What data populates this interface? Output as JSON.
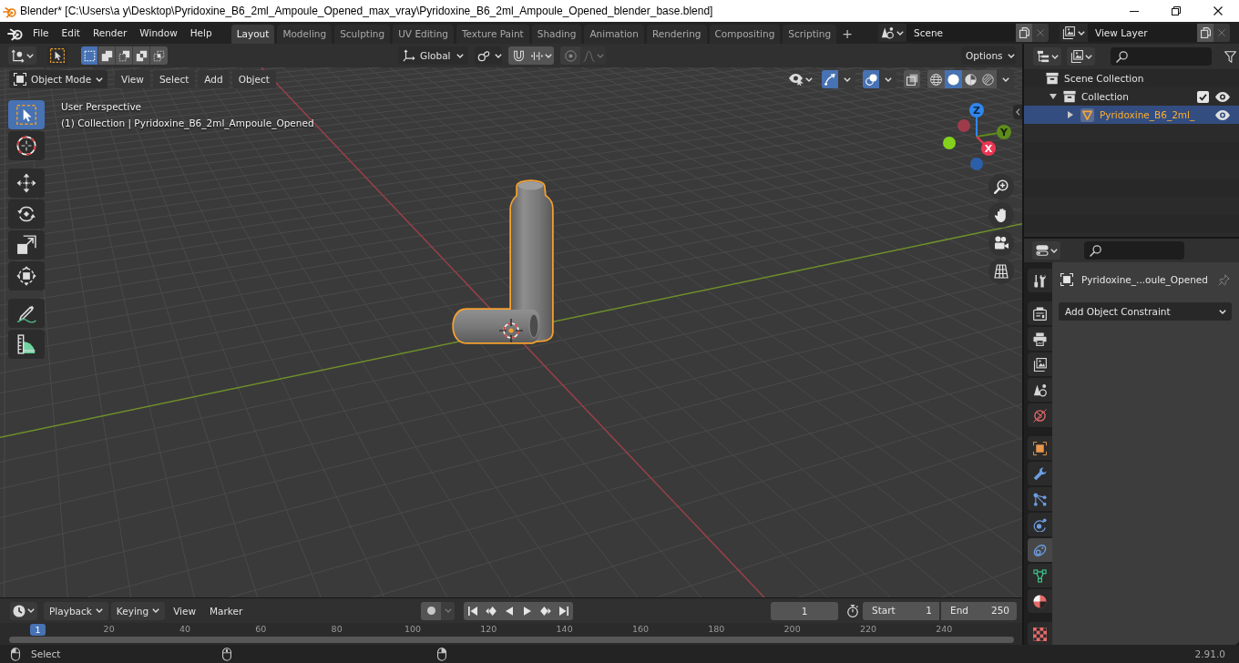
{
  "title_bar": {
    "title": "Blender* [C:\\Users\\a y\\Desktop\\Pyridoxine_B6_2ml_Ampoule_Opened_max_vray\\Pyridoxine_B6_2ml_Ampoule_Opened_blender_base.blend]"
  },
  "top_bar": {
    "menus": [
      "File",
      "Edit",
      "Render",
      "Window",
      "Help"
    ],
    "workspaces": [
      {
        "label": "Layout",
        "selected": true
      },
      {
        "label": "Modeling",
        "selected": false
      },
      {
        "label": "Sculpting",
        "selected": false
      },
      {
        "label": "UV Editing",
        "selected": false
      },
      {
        "label": "Texture Paint",
        "selected": false
      },
      {
        "label": "Shading",
        "selected": false
      },
      {
        "label": "Animation",
        "selected": false
      },
      {
        "label": "Rendering",
        "selected": false
      },
      {
        "label": "Compositing",
        "selected": false
      },
      {
        "label": "Scripting",
        "selected": false
      }
    ],
    "add_workspace": "+",
    "scene": "Scene",
    "view_layer": "View Layer"
  },
  "tool_header": {
    "select_modes": [
      {
        "kind": "set",
        "selected": true
      },
      {
        "kind": "extend",
        "selected": false
      },
      {
        "kind": "subtract",
        "selected": false
      },
      {
        "kind": "invert",
        "selected": false
      },
      {
        "kind": "intersect",
        "selected": false
      }
    ],
    "orientation": "Global",
    "options": "Options"
  },
  "viewport_header": {
    "mode": "Object Mode",
    "menus": [
      "View",
      "Select",
      "Add",
      "Object"
    ],
    "gizmos_on": true,
    "overlays_on": true,
    "xray_on": false,
    "shading": [
      {
        "kind": "wireframe",
        "selected": false
      },
      {
        "kind": "solid",
        "selected": true
      },
      {
        "kind": "material",
        "selected": false
      },
      {
        "kind": "rendered",
        "selected": false
      }
    ]
  },
  "viewport": {
    "view_name": "User Perspective",
    "info": "(1) Collection | Pyridoxine_B6_2ml_Ampoule_Opened",
    "tool_groups": [
      [
        {
          "kind": "select_box",
          "selected": true
        },
        {
          "kind": "cursor",
          "selected": false
        }
      ],
      [
        {
          "kind": "move",
          "selected": false
        },
        {
          "kind": "rotate",
          "selected": false
        },
        {
          "kind": "scale",
          "selected": false
        },
        {
          "kind": "transform",
          "selected": false
        }
      ],
      [
        {
          "kind": "annotate",
          "selected": false
        },
        {
          "kind": "measure",
          "selected": false
        }
      ]
    ],
    "axes": [
      {
        "kind": "z",
        "label": "Z"
      },
      {
        "kind": "y",
        "label": "Y"
      },
      {
        "kind": "x",
        "label": "X"
      }
    ]
  },
  "outliner": {
    "items": [
      {
        "kind": "scene_collection",
        "label": "Scene Collection",
        "selected": false,
        "children": [
          {
            "kind": "collection",
            "label": "Collection",
            "expanded": true,
            "selected": false,
            "included": true,
            "visible": true,
            "children": [
              {
                "kind": "mesh_object",
                "label": "Pyridoxine_B6_2ml_",
                "expanded": false,
                "selected": true,
                "visible": true
              }
            ]
          }
        ]
      }
    ]
  },
  "properties": {
    "tab_groups": [
      [
        {
          "kind": "tool",
          "selected": false
        }
      ],
      [
        {
          "kind": "render",
          "selected": false
        },
        {
          "kind": "output",
          "selected": false
        },
        {
          "kind": "view_layer",
          "selected": false
        },
        {
          "kind": "scene",
          "selected": false
        },
        {
          "kind": "world",
          "selected": false
        }
      ],
      [
        {
          "kind": "object",
          "selected": false
        },
        {
          "kind": "modifiers",
          "selected": false
        },
        {
          "kind": "particles",
          "selected": false
        },
        {
          "kind": "physics",
          "selected": false
        },
        {
          "kind": "constraints",
          "selected": true
        },
        {
          "kind": "data",
          "selected": false
        },
        {
          "kind": "material",
          "selected": false
        }
      ],
      [
        {
          "kind": "texture",
          "selected": false
        }
      ]
    ],
    "object_name": "Pyridoxine_...oule_Opened",
    "add_constraint": "Add Object Constraint"
  },
  "timeline": {
    "menus": [
      {
        "kind": "dropdown",
        "label": "Playback"
      },
      {
        "kind": "dropdown",
        "label": "Keying"
      },
      {
        "kind": "menu",
        "label": "View"
      },
      {
        "kind": "menu",
        "label": "Marker"
      }
    ],
    "auto_keying": false,
    "current_frame": "1",
    "start_label": "Start",
    "start": "1",
    "end_label": "End",
    "end": "250",
    "playhead": "1",
    "ruler": [
      "20",
      "40",
      "60",
      "80",
      "100",
      "120",
      "140",
      "160",
      "180",
      "200",
      "220",
      "240"
    ]
  },
  "status_bar": {
    "hint": "Select",
    "version": "2.91.0"
  }
}
